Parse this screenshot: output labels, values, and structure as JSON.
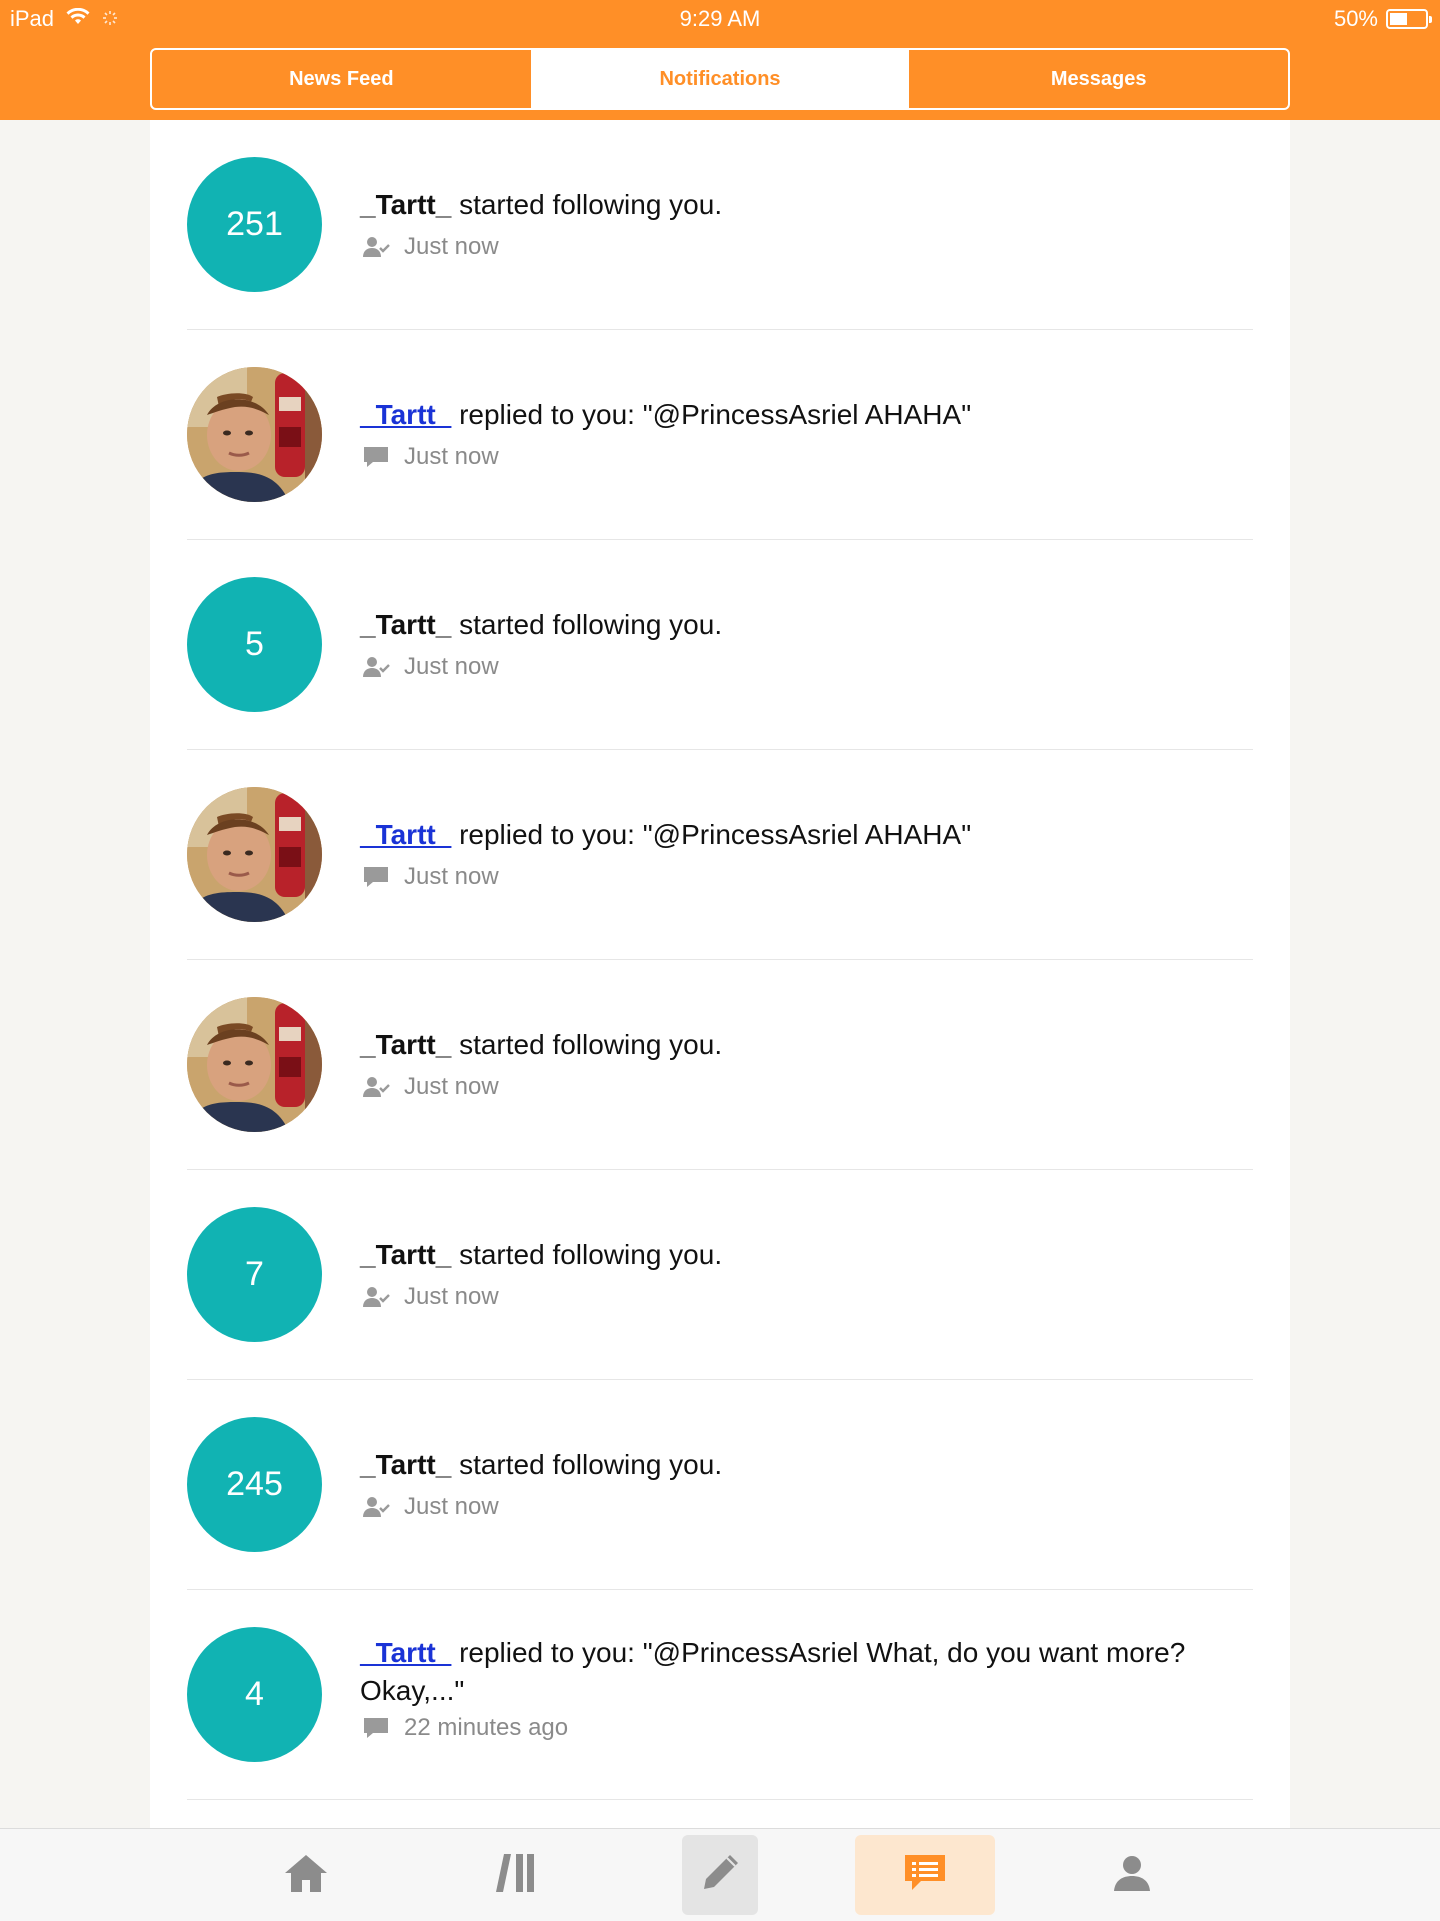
{
  "status_bar": {
    "device": "iPad",
    "time": "9:29 AM",
    "battery_text": "50%",
    "battery_level": 0.5
  },
  "tabs": [
    {
      "label": "News Feed",
      "active": false
    },
    {
      "label": "Notifications",
      "active": true
    },
    {
      "label": "Messages",
      "active": false
    }
  ],
  "notifications": [
    {
      "avatar_text": "251",
      "avatar_type": "number",
      "username": "_Tartt_",
      "linked": false,
      "message": " started following you.",
      "type_icon": "user-check-icon",
      "time": "Just now"
    },
    {
      "avatar_text": "",
      "avatar_type": "photo",
      "username": "_Tartt_",
      "linked": true,
      "message": " replied to you: \"@PrincessAsriel AHAHA\"",
      "type_icon": "comment-icon",
      "time": "Just now"
    },
    {
      "avatar_text": "5",
      "avatar_type": "number",
      "username": "_Tartt_",
      "linked": false,
      "message": " started following you.",
      "type_icon": "user-check-icon",
      "time": "Just now"
    },
    {
      "avatar_text": "",
      "avatar_type": "photo",
      "username": "_Tartt_",
      "linked": true,
      "message": " replied to you: \"@PrincessAsriel AHAHA\"",
      "type_icon": "comment-icon",
      "time": "Just now"
    },
    {
      "avatar_text": "",
      "avatar_type": "photo",
      "username": "_Tartt_",
      "linked": false,
      "message": " started following you.",
      "type_icon": "user-check-icon",
      "time": "Just now"
    },
    {
      "avatar_text": "7",
      "avatar_type": "number",
      "username": "_Tartt_",
      "linked": false,
      "message": " started following you.",
      "type_icon": "user-check-icon",
      "time": "Just now"
    },
    {
      "avatar_text": "245",
      "avatar_type": "number",
      "username": "_Tartt_",
      "linked": false,
      "message": " started following you.",
      "type_icon": "user-check-icon",
      "time": "Just now"
    },
    {
      "avatar_text": "4",
      "avatar_type": "number",
      "username": "_Tartt_",
      "linked": true,
      "message": " replied to you: \"@PrincessAsriel What, do you want more? Okay,...\"",
      "type_icon": "comment-icon",
      "time": "22 minutes ago"
    }
  ],
  "bottom_nav": [
    {
      "icon": "home-icon",
      "active": false
    },
    {
      "icon": "library-icon",
      "active": false
    },
    {
      "icon": "pencil-icon",
      "active": false
    },
    {
      "icon": "notifications-list-icon",
      "active": true
    },
    {
      "icon": "profile-icon",
      "active": false
    }
  ],
  "colors": {
    "brand_orange": "#ff8f27",
    "avatar_teal": "#11b3b3",
    "link_blue": "#1a33d6"
  }
}
